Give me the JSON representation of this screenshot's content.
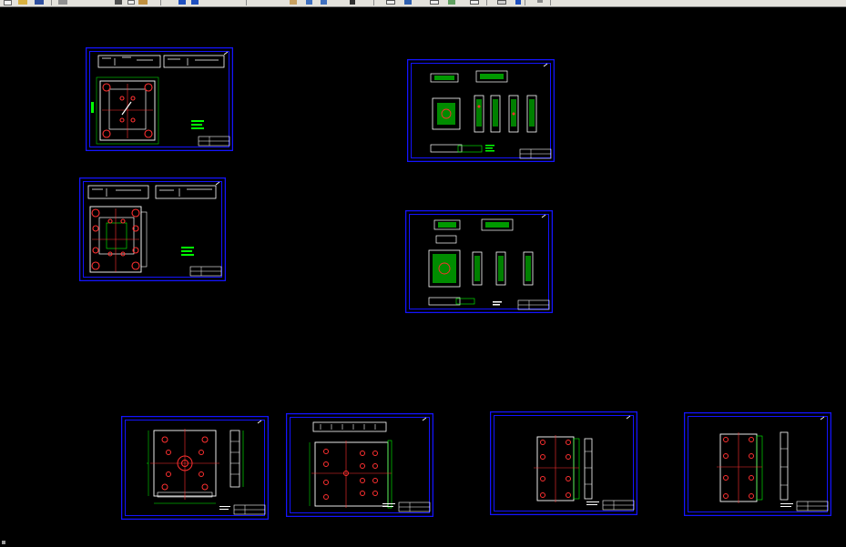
{
  "app": {
    "toolbar_icons": [
      "new-icon",
      "open-icon",
      "save-icon",
      "print-icon",
      "cut-icon",
      "copy-icon",
      "paste-icon",
      "undo-icon",
      "redo-icon",
      "pan-icon",
      "zoom-icon",
      "zoom-window-icon",
      "zoom-previous-icon",
      "properties-icon",
      "design-center-icon",
      "tool-palettes-icon",
      "sheet-set-icon",
      "markup-icon",
      "calculator-icon",
      "help-icon"
    ],
    "colors": {
      "background": "#000000",
      "frame": "#1414ff",
      "geometry": "#ffffff",
      "dimension": "#00ff00",
      "hole": "#ff3030",
      "accent": "#00ffff",
      "toolbar": "#e4e2dc"
    }
  },
  "model_space": {
    "sheets": [
      {
        "name": "mold-assembly-sheet-1",
        "kind": "assembly"
      },
      {
        "name": "mold-assembly-sheet-2",
        "kind": "assembly"
      },
      {
        "name": "part-detail-sheet-1",
        "kind": "parts"
      },
      {
        "name": "part-detail-sheet-2",
        "kind": "parts"
      },
      {
        "name": "plate-sheet-1",
        "kind": "plate-round"
      },
      {
        "name": "plate-sheet-2",
        "kind": "plate-grid"
      },
      {
        "name": "plate-sheet-3",
        "kind": "plate-side"
      },
      {
        "name": "plate-sheet-4",
        "kind": "plate-side"
      }
    ]
  }
}
